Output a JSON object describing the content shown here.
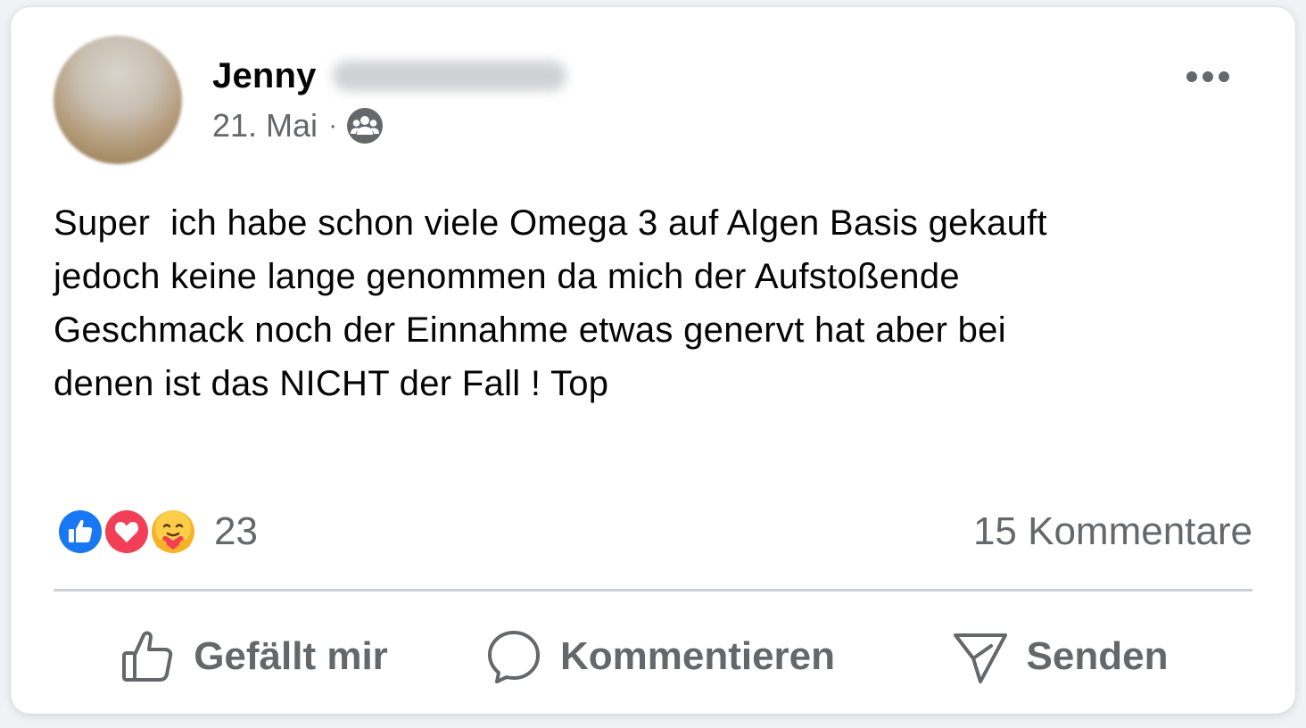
{
  "post": {
    "author_name": "Jenny",
    "date": "21. Mai",
    "separator": "·",
    "audience_icon": "group-audience-icon",
    "more_icon": "more-options-icon",
    "text": "Super  ich habe schon viele Omega 3 auf Algen Basis gekauft\njedoch keine lange genommen da mich der Aufstoßende\nGeschmack noch der Einnahme etwas genervt hat aber bei\ndenen ist das NICHT der Fall ! Top"
  },
  "reactions": {
    "icons": [
      "like-reaction-icon",
      "love-reaction-icon",
      "care-reaction-icon"
    ],
    "count": "23"
  },
  "comments": {
    "label": "15 Kommentare"
  },
  "actions": {
    "like_label": "Gefällt mir",
    "comment_label": "Kommentieren",
    "send_label": "Senden"
  },
  "colors": {
    "like_blue": "#1877f2",
    "love_red": "#f33e58",
    "care_yellow": "#f7b125",
    "secondary_text": "#65676b",
    "primary_text": "#050505"
  }
}
